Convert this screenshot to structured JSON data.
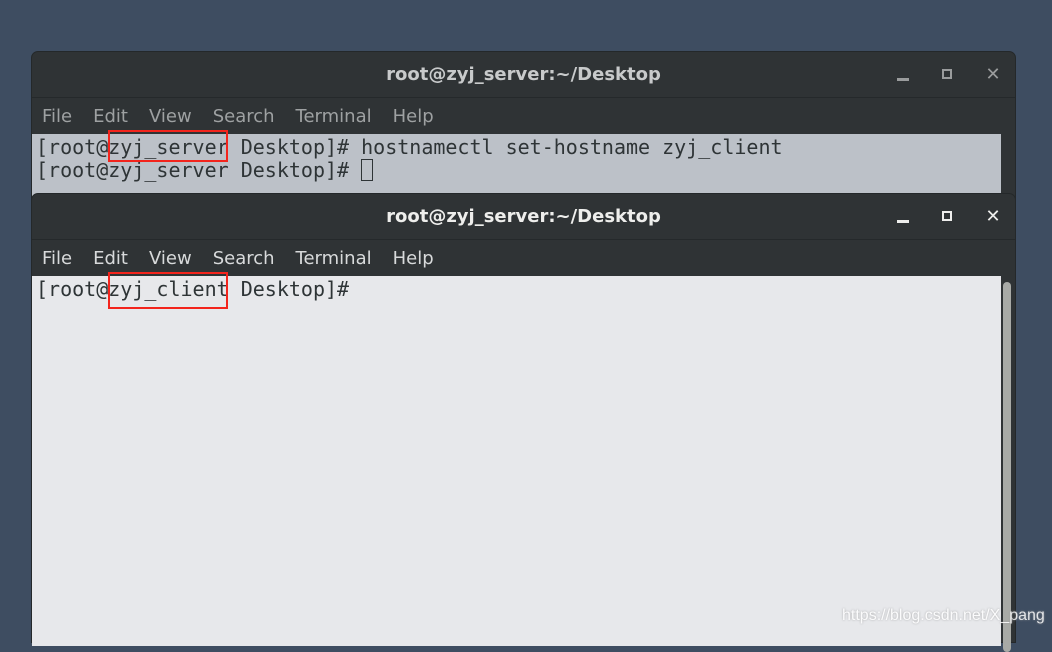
{
  "windows": [
    {
      "title": "root@zyj_server:~/Desktop",
      "menu": [
        "File",
        "Edit",
        "View",
        "Search",
        "Terminal",
        "Help"
      ],
      "lines": [
        "[root@zyj_server Desktop]# hostnamectl set-hostname zyj_client",
        "[root@zyj_server Desktop]# "
      ]
    },
    {
      "title": "root@zyj_server:~/Desktop",
      "menu": [
        "File",
        "Edit",
        "View",
        "Search",
        "Terminal",
        "Help"
      ],
      "lines": [
        "[root@zyj_client Desktop]#"
      ]
    }
  ],
  "controls": {
    "minimize": "minimize-icon",
    "maximize": "maximize-icon",
    "close": "✕"
  },
  "highlight_color": "#f3241c",
  "watermark": "https://blog.csdn.net/X_pang"
}
